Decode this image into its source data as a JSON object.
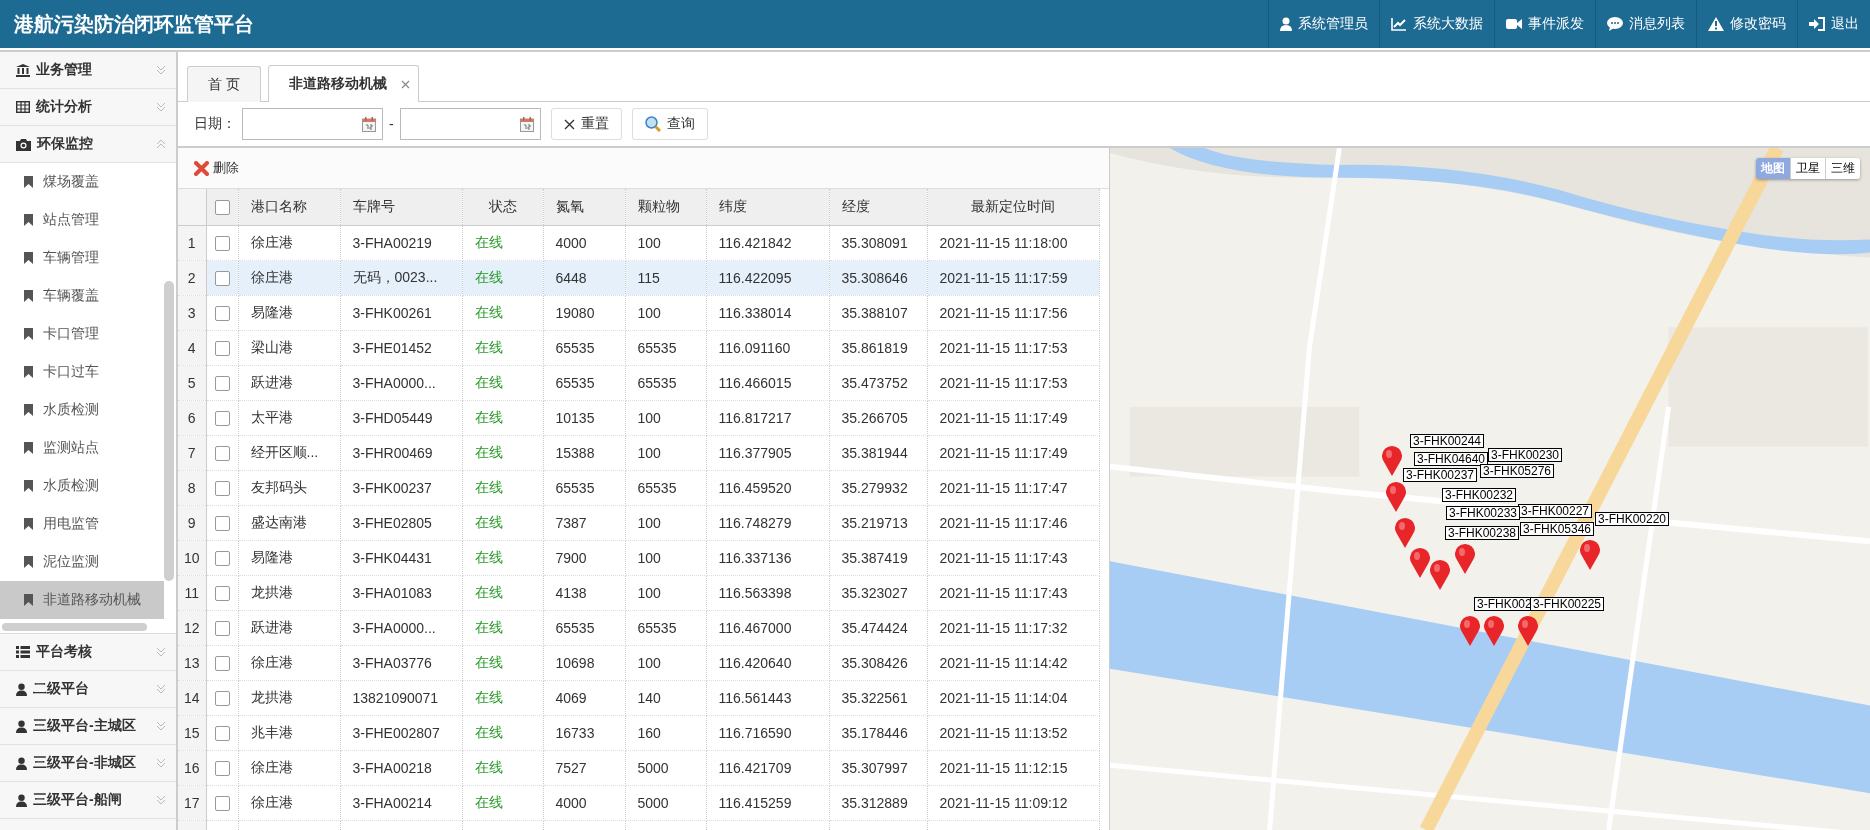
{
  "header": {
    "title": "港航污染防治闭环监管平台",
    "menu": [
      {
        "label": "系统管理员"
      },
      {
        "label": "系统大数据"
      },
      {
        "label": "事件派发"
      },
      {
        "label": "消息列表"
      },
      {
        "label": "修改密码"
      },
      {
        "label": "退出"
      }
    ]
  },
  "sidebar": {
    "groups": [
      {
        "label": "业务管理",
        "expanded": false
      },
      {
        "label": "统计分析",
        "expanded": false
      },
      {
        "label": "环保监控",
        "expanded": true,
        "items": [
          {
            "label": "煤场覆盖",
            "selected": false
          },
          {
            "label": "站点管理",
            "selected": false
          },
          {
            "label": "车辆管理",
            "selected": false
          },
          {
            "label": "车辆覆盖",
            "selected": false
          },
          {
            "label": "卡口管理",
            "selected": false
          },
          {
            "label": "卡口过车",
            "selected": false
          },
          {
            "label": "水质检测",
            "selected": false
          },
          {
            "label": "监测站点",
            "selected": false
          },
          {
            "label": "水质检测",
            "selected": false
          },
          {
            "label": "用电监管",
            "selected": false
          },
          {
            "label": "泥位监测",
            "selected": false
          },
          {
            "label": "非道路移动机械",
            "selected": true
          }
        ]
      },
      {
        "label": "平台考核",
        "expanded": false
      },
      {
        "label": "二级平台",
        "expanded": false
      },
      {
        "label": "三级平台-主城区",
        "expanded": false
      },
      {
        "label": "三级平台-非城区",
        "expanded": false
      },
      {
        "label": "三级平台-船闸",
        "expanded": false
      }
    ]
  },
  "tabs": [
    {
      "label": "首 页",
      "selected": false,
      "closable": false
    },
    {
      "label": "非道路移动机械",
      "selected": true,
      "closable": true
    }
  ],
  "query": {
    "date_label": "日期：",
    "separator": "-",
    "buttons": [
      "重置",
      "查询"
    ]
  },
  "toolbar": {
    "delete": "删除"
  },
  "table": {
    "header_checked": false,
    "columns": [
      "港口名称",
      "车牌号",
      "状态",
      "氮氧",
      "颗粒物",
      "纬度",
      "经度",
      "最新定位时间"
    ],
    "rows": [
      {
        "index": "1",
        "checked": false,
        "selected": false,
        "cells": [
          "徐庄港",
          "3-FHA00219",
          "在线",
          "4000",
          "100",
          "116.421842",
          "35.308091",
          "2021-11-15 11:18:00"
        ]
      },
      {
        "index": "2",
        "checked": false,
        "selected": true,
        "cells": [
          "徐庄港",
          "无码，0023...",
          "在线",
          "6448",
          "115",
          "116.422095",
          "35.308646",
          "2021-11-15 11:17:59"
        ]
      },
      {
        "index": "3",
        "checked": false,
        "selected": false,
        "cells": [
          "易隆港",
          "3-FHK00261",
          "在线",
          "19080",
          "100",
          "116.338014",
          "35.388107",
          "2021-11-15 11:17:56"
        ]
      },
      {
        "index": "4",
        "checked": false,
        "selected": false,
        "cells": [
          "梁山港",
          "3-FHE01452",
          "在线",
          "65535",
          "65535",
          "116.091160",
          "35.861819",
          "2021-11-15 11:17:53"
        ]
      },
      {
        "index": "5",
        "checked": false,
        "selected": false,
        "cells": [
          "跃进港",
          "3-FHA0000...",
          "在线",
          "65535",
          "65535",
          "116.466015",
          "35.473752",
          "2021-11-15 11:17:53"
        ]
      },
      {
        "index": "6",
        "checked": false,
        "selected": false,
        "cells": [
          "太平港",
          "3-FHD05449",
          "在线",
          "10135",
          "100",
          "116.817217",
          "35.266705",
          "2021-11-15 11:17:49"
        ]
      },
      {
        "index": "7",
        "checked": false,
        "selected": false,
        "cells": [
          "经开区顺...",
          "3-FHR00469",
          "在线",
          "15388",
          "100",
          "116.377905",
          "35.381944",
          "2021-11-15 11:17:49"
        ]
      },
      {
        "index": "8",
        "checked": false,
        "selected": false,
        "cells": [
          "友邦码头",
          "3-FHK00237",
          "在线",
          "65535",
          "65535",
          "116.459520",
          "35.279932",
          "2021-11-15 11:17:47"
        ]
      },
      {
        "index": "9",
        "checked": false,
        "selected": false,
        "cells": [
          "盛达南港",
          "3-FHE02805",
          "在线",
          "7387",
          "100",
          "116.748279",
          "35.219713",
          "2021-11-15 11:17:46"
        ]
      },
      {
        "index": "10",
        "checked": false,
        "selected": false,
        "cells": [
          "易隆港",
          "3-FHK04431",
          "在线",
          "7900",
          "100",
          "116.337136",
          "35.387419",
          "2021-11-15 11:17:43"
        ]
      },
      {
        "index": "11",
        "checked": false,
        "selected": false,
        "cells": [
          "龙拱港",
          "3-FHA01083",
          "在线",
          "4138",
          "100",
          "116.563398",
          "35.323027",
          "2021-11-15 11:17:43"
        ]
      },
      {
        "index": "12",
        "checked": false,
        "selected": false,
        "cells": [
          "跃进港",
          "3-FHA0000...",
          "在线",
          "65535",
          "65535",
          "116.467000",
          "35.474424",
          "2021-11-15 11:17:32"
        ]
      },
      {
        "index": "13",
        "checked": false,
        "selected": false,
        "cells": [
          "徐庄港",
          "3-FHA03776",
          "在线",
          "10698",
          "100",
          "116.420640",
          "35.308426",
          "2021-11-15 11:14:42"
        ]
      },
      {
        "index": "14",
        "checked": false,
        "selected": false,
        "cells": [
          "龙拱港",
          "13821090071",
          "在线",
          "4069",
          "140",
          "116.561443",
          "35.322561",
          "2021-11-15 11:14:04"
        ]
      },
      {
        "index": "15",
        "checked": false,
        "selected": false,
        "cells": [
          "兆丰港",
          "3-FHE002807",
          "在线",
          "16733",
          "160",
          "116.716590",
          "35.178446",
          "2021-11-15 11:13:52"
        ]
      },
      {
        "index": "16",
        "checked": false,
        "selected": false,
        "cells": [
          "徐庄港",
          "3-FHA00218",
          "在线",
          "7527",
          "5000",
          "116.421709",
          "35.307997",
          "2021-11-15 11:12:15"
        ]
      },
      {
        "index": "17",
        "checked": false,
        "selected": false,
        "cells": [
          "徐庄港",
          "3-FHA00214",
          "在线",
          "4000",
          "5000",
          "116.415259",
          "35.312889",
          "2021-11-15 11:09:12"
        ]
      }
    ]
  },
  "map": {
    "layers": [
      {
        "label": "地图",
        "selected": true
      },
      {
        "label": "卫星",
        "selected": false
      },
      {
        "label": "三维",
        "selected": false
      }
    ],
    "markers": [
      {
        "label": "3-FHK00244"
      },
      {
        "label": "3-FHK04640"
      },
      {
        "label": "3-FHK00230"
      },
      {
        "label": "3-FHK00237"
      },
      {
        "label": "3-FHK05276"
      },
      {
        "label": "3-FHK00232"
      },
      {
        "label": "3-FHK00227"
      },
      {
        "label": "3-FHK00233"
      },
      {
        "label": "3-FHK05346"
      },
      {
        "label": "3-FHK00238"
      },
      {
        "label": "3-FHK00220"
      },
      {
        "label": "3-FHK002"
      },
      {
        "label": "3-FHK00225"
      }
    ]
  }
}
